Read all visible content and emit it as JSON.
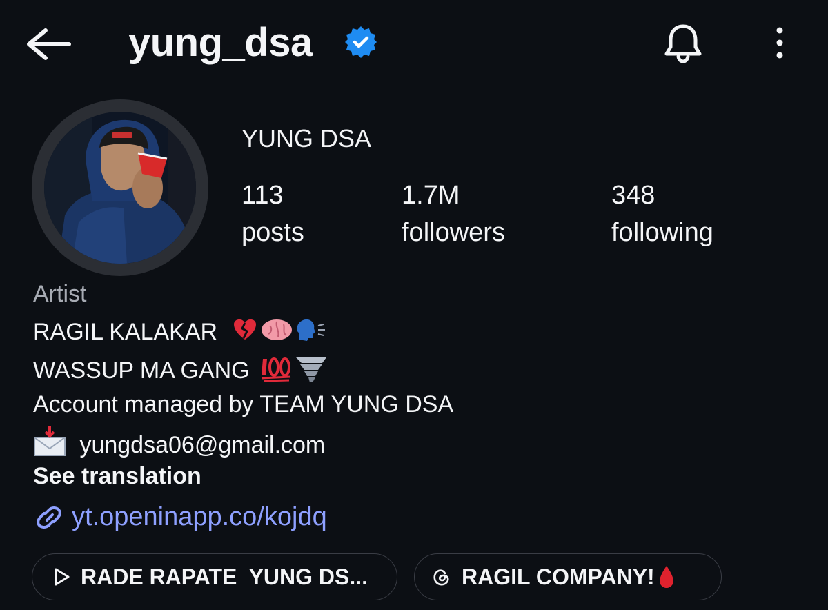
{
  "header": {
    "username": "yung_dsa",
    "icons": {
      "back": "arrow-left-icon",
      "verified": "verified-badge-icon",
      "bell": "bell-icon",
      "more": "more-vertical-icon"
    }
  },
  "profile": {
    "display_name": "YUNG DSA",
    "stats": [
      {
        "value": "113",
        "label": "posts"
      },
      {
        "value": "1.7M",
        "label": "followers"
      },
      {
        "value": "348",
        "label": "following"
      }
    ]
  },
  "bio": {
    "category": "Artist",
    "line1_text": "RAGIL KALAKAR",
    "line2_text": "WASSUP MA GANG",
    "line3": "Account managed by TEAM YUNG DSA",
    "email": "yungdsa06@gmail.com",
    "see_translation": "See translation",
    "link": "yt.openinapp.co/kojdq",
    "emojis": [
      "broken-heart",
      "brain",
      "speaking-head",
      "hundred-points",
      "tornado",
      "envelope-with-arrow"
    ]
  },
  "chips": [
    {
      "label": "RADE RAPATE  YUNG DS...",
      "icon": "play-icon"
    },
    {
      "label": "RAGIL COMPANY!",
      "icon": "threads-icon",
      "emoji": "drop-of-blood"
    }
  ],
  "colors": {
    "background": "#0c0f14",
    "text": "#f4f5f7",
    "muted": "#a7abb3",
    "link": "#8ea0ff",
    "verified": "#1f8cf2"
  }
}
